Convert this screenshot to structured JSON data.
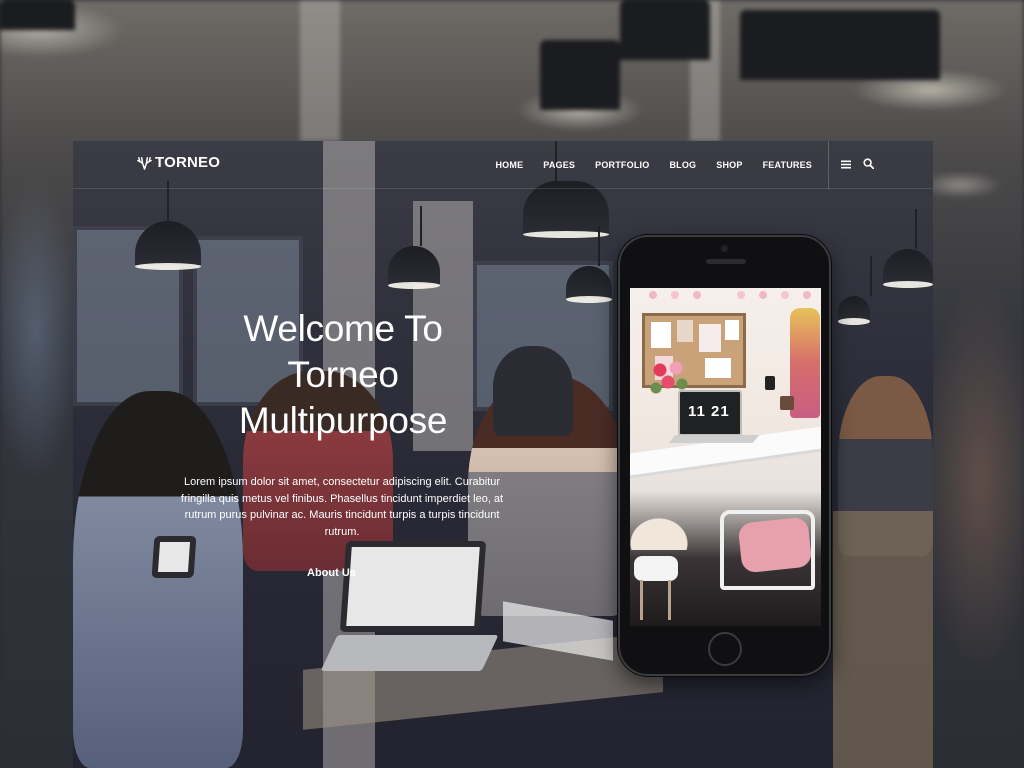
{
  "brand": {
    "name": "TORNEO",
    "icon": "deer-antlers-icon"
  },
  "nav": {
    "items": [
      "HOME",
      "PAGES",
      "PORTFOLIO",
      "BLOG",
      "SHOP",
      "FEATURES"
    ],
    "icons": [
      "hamburger-menu-icon",
      "search-icon"
    ]
  },
  "hero": {
    "title_line1": "Welcome To",
    "title_line2": "Torneo",
    "title_line3": "Multipurpose",
    "text": "Lorem ipsum dolor sit amet, consectetur adipiscing elit. Curabitur fringilla quis metus vel finibus. Phasellus tincidunt imperdiet leo, at rutrum purus pulvinar ac. Mauris tincidunt turpis a turpis tincidunt rutrum.",
    "link": "About Us"
  },
  "phone": {
    "laptop_clock": "11 21"
  },
  "colors": {
    "overlay": "#1f2233",
    "text": "#ffffff"
  }
}
